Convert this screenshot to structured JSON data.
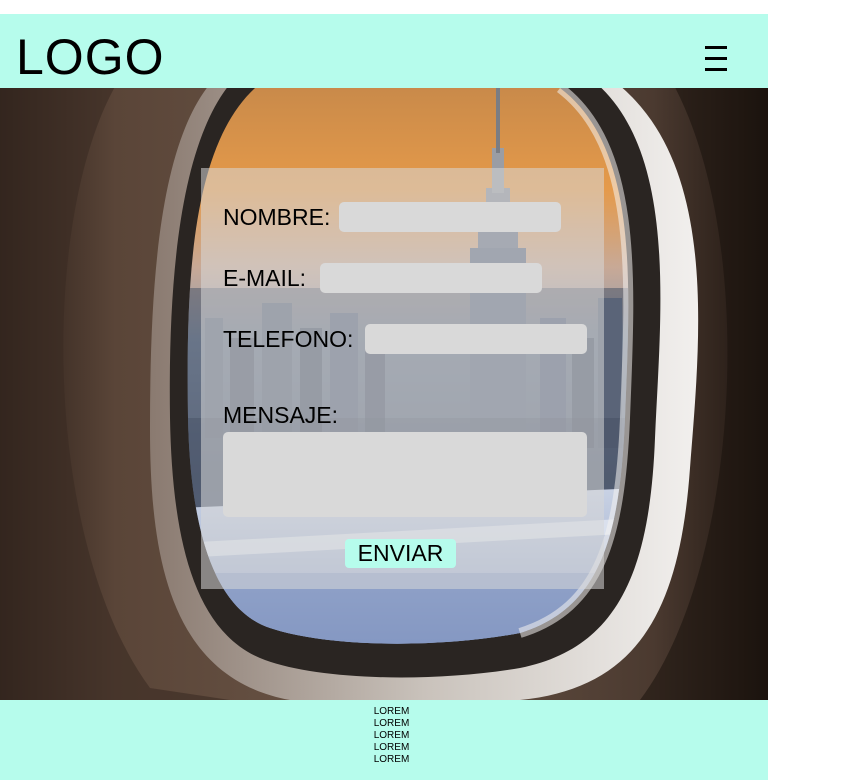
{
  "header": {
    "logo": "LOGO",
    "menu_icon": "hamburger-menu-icon"
  },
  "hero": {
    "image": "airplane-window-city-view"
  },
  "form": {
    "nombre_label": "NOMBRE:",
    "nombre_value": "",
    "email_label": "E-MAIL:",
    "email_value": "",
    "telefono_label": "TELEFONO:",
    "telefono_value": "",
    "mensaje_label": "MENSAJE:",
    "mensaje_value": "",
    "submit_label": "ENVIAR"
  },
  "footer": {
    "lines": [
      "LOREM",
      "LOREM",
      "LOREM",
      "LOREM",
      "LOREM"
    ]
  },
  "colors": {
    "accent": "#b6fcec",
    "field": "#d9d9d9"
  }
}
